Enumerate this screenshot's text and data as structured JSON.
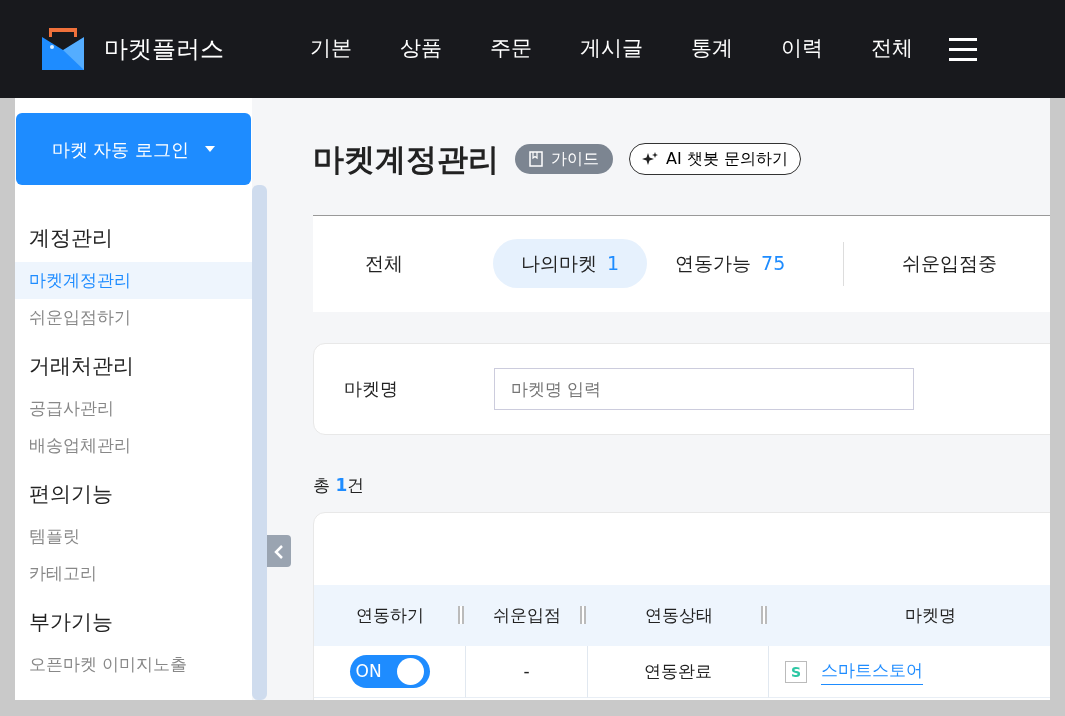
{
  "header": {
    "brand": "마켓플러스",
    "nav": [
      {
        "label": "기본"
      },
      {
        "label": "상품"
      },
      {
        "label": "주문"
      },
      {
        "label": "게시글"
      },
      {
        "label": "통계"
      },
      {
        "label": "이력"
      },
      {
        "label": "전체"
      }
    ]
  },
  "sidebar": {
    "login_button": "마켓 자동 로그인",
    "sections": [
      {
        "title": "계정관리",
        "items": [
          {
            "label": "마켓계정관리",
            "selected": true
          },
          {
            "label": "쉬운입점하기",
            "selected": false
          }
        ]
      },
      {
        "title": "거래처관리",
        "items": [
          {
            "label": "공급사관리",
            "selected": false
          },
          {
            "label": "배송업체관리",
            "selected": false
          }
        ]
      },
      {
        "title": "편의기능",
        "items": [
          {
            "label": "템플릿",
            "selected": false
          },
          {
            "label": "카테고리",
            "selected": false
          }
        ]
      },
      {
        "title": "부가기능",
        "items": [
          {
            "label": "오픈마켓 이미지노출",
            "selected": false
          }
        ]
      }
    ]
  },
  "page": {
    "title": "마켓계정관리",
    "guide_button": "가이드",
    "ai_button": "AI 챗봇 문의하기"
  },
  "tabs": [
    {
      "label": "전체",
      "selected": false
    },
    {
      "label": "나의마켓",
      "count": "1",
      "selected": true
    },
    {
      "label": "연동가능",
      "count": "75",
      "selected": false
    },
    {
      "label": "쉬운입점중",
      "selected": false
    }
  ],
  "filter": {
    "label": "마켓명",
    "placeholder": "마켓명 입력"
  },
  "total": {
    "prefix": "총",
    "count": "1",
    "suffix": "건"
  },
  "table": {
    "columns": [
      "연동하기",
      "쉬운입점",
      "연동상태",
      "마켓명"
    ],
    "rows": [
      {
        "linked": true,
        "toggle_label": "ON",
        "easy_entry": "-",
        "status": "연동완료",
        "market_icon": "S",
        "market": "스마트스토어"
      }
    ]
  }
}
